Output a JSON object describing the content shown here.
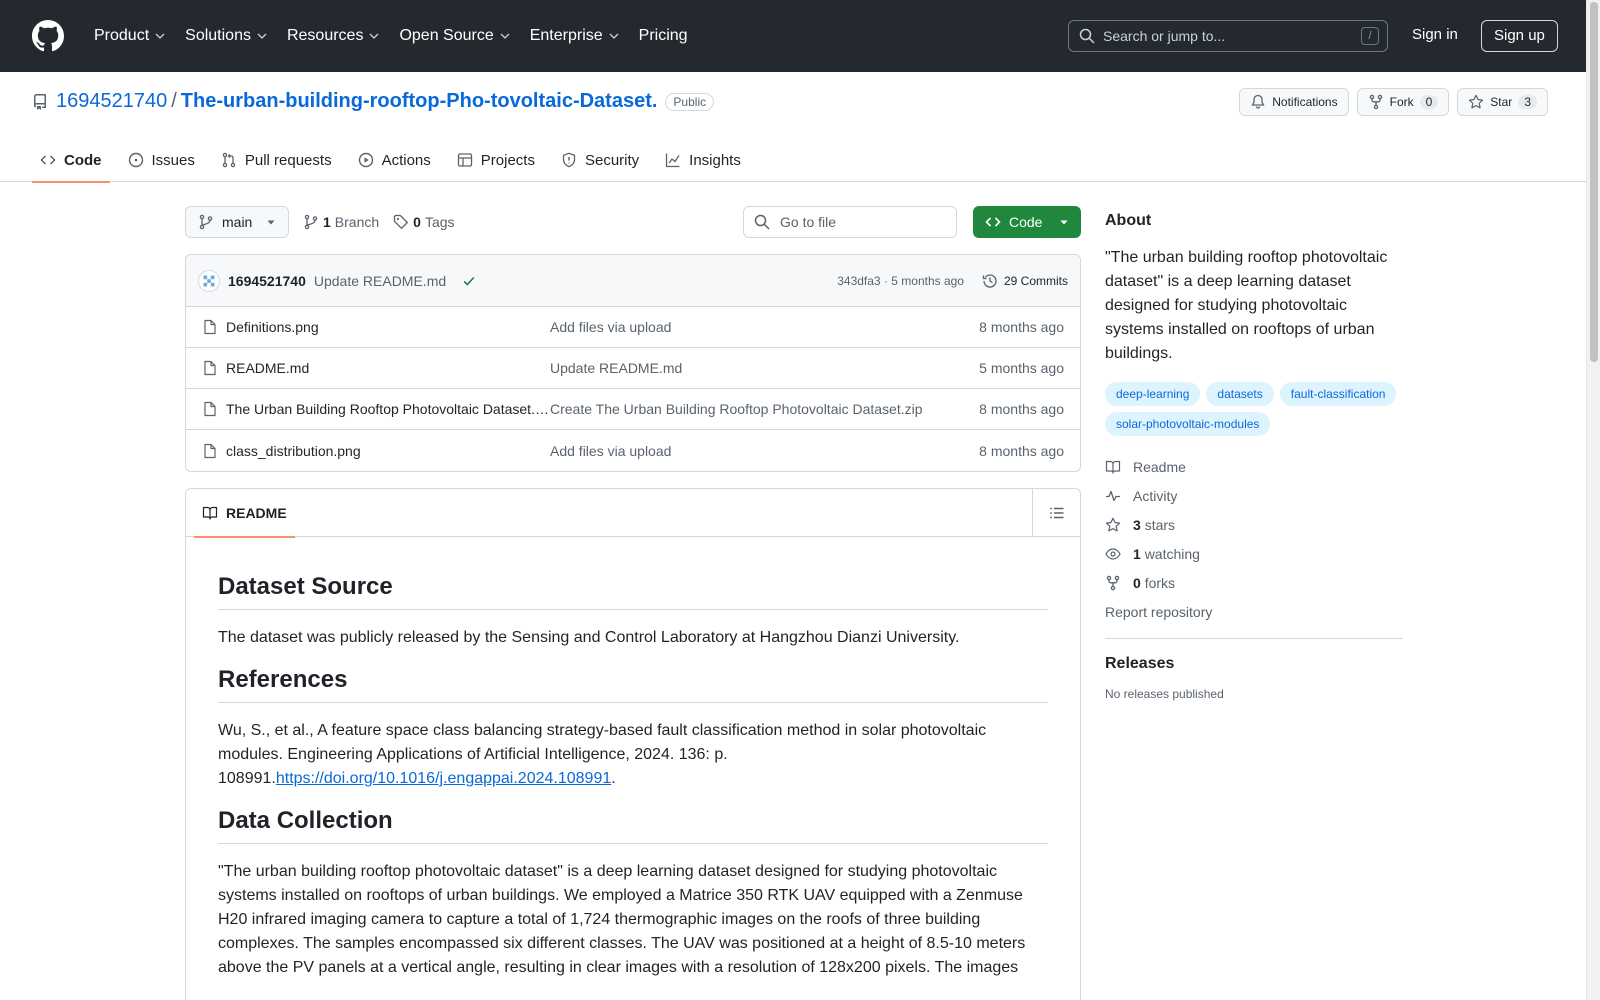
{
  "header": {
    "nav": [
      {
        "label": "Product",
        "has_menu": true
      },
      {
        "label": "Solutions",
        "has_menu": true
      },
      {
        "label": "Resources",
        "has_menu": true
      },
      {
        "label": "Open Source",
        "has_menu": true
      },
      {
        "label": "Enterprise",
        "has_menu": true
      },
      {
        "label": "Pricing",
        "has_menu": false
      }
    ],
    "search_placeholder": "Search or jump to...",
    "search_shortcut": "/",
    "sign_in": "Sign in",
    "sign_up": "Sign up"
  },
  "repo": {
    "owner": "1694521740",
    "separator": "/",
    "name": "The-urban-building-rooftop-Pho-tovoltaic-Dataset.",
    "visibility": "Public",
    "notifications_label": "Notifications",
    "fork_label": "Fork",
    "fork_count": "0",
    "star_label": "Star",
    "star_count": "3",
    "tabs": [
      {
        "label": "Code",
        "icon": "code-icon",
        "active": true
      },
      {
        "label": "Issues",
        "icon": "issue-icon",
        "active": false
      },
      {
        "label": "Pull requests",
        "icon": "pull-request-icon",
        "active": false
      },
      {
        "label": "Actions",
        "icon": "play-icon",
        "active": false
      },
      {
        "label": "Projects",
        "icon": "table-icon",
        "active": false
      },
      {
        "label": "Security",
        "icon": "shield-icon",
        "active": false
      },
      {
        "label": "Insights",
        "icon": "graph-icon",
        "active": false
      }
    ]
  },
  "toolbar": {
    "branch": "main",
    "branch_count": "1",
    "branch_label": "Branch",
    "tag_count": "0",
    "tag_label": "Tags",
    "goto_placeholder": "Go to file",
    "code_button": "Code"
  },
  "latest_commit": {
    "author": "1694521740",
    "message": "Update README.md",
    "meta": "343dfa3 · 5 months ago",
    "commits_label": "29 Commits"
  },
  "files": [
    {
      "name": "Definitions.png",
      "commit": "Add files via upload",
      "age": "8 months ago"
    },
    {
      "name": "README.md",
      "commit": "Update README.md",
      "age": "5 months ago"
    },
    {
      "name": "The Urban Building Rooftop Photovoltaic Dataset.zip",
      "commit": "Create The Urban Building Rooftop Photovoltaic Dataset.zip",
      "age": "8 months ago"
    },
    {
      "name": "class_distribution.png",
      "commit": "Add files via upload",
      "age": "8 months ago"
    }
  ],
  "readme": {
    "tab_label": "README",
    "h_source": "Dataset Source",
    "p_source": "The dataset was publicly released by the Sensing and Control Laboratory at Hangzhou Dianzi University.",
    "h_refs": "References",
    "p_refs": "Wu, S., et al., A feature space class balancing strategy-based fault classification method in solar photovoltaic modules. Engineering Applications of Artificial Intelligence, 2024. 136: p. 108991.",
    "refs_link": "https://doi.org/10.1016/j.engappai.2024.108991",
    "refs_end": ".",
    "h_collection": "Data Collection",
    "p_collection": "\"The urban building rooftop photovoltaic dataset\" is a deep learning dataset designed for studying photovoltaic systems installed on rooftops of urban buildings. We employed a Matrice 350 RTK UAV equipped with a Zenmuse H20 infrared imaging camera to capture a total of 1,724 thermographic images on the roofs of three building complexes. The samples encompassed six different classes. The UAV was positioned at a height of 8.5-10 meters above the PV panels at a vertical angle, resulting in clear images with a resolution of 128x200 pixels. The images"
  },
  "about": {
    "heading": "About",
    "description": "\"The urban building rooftop photovoltaic dataset\" is a deep learning dataset designed for studying photovoltaic systems installed on rooftops of urban buildings.",
    "topics": [
      "deep-learning",
      "datasets",
      "fault-classification",
      "solar-photovoltaic-modules"
    ],
    "readme_label": "Readme",
    "activity_label": "Activity",
    "stars_count": "3",
    "stars_label": "stars",
    "watching_count": "1",
    "watching_label": "watching",
    "forks_count": "0",
    "forks_label": "forks",
    "report": "Report repository"
  },
  "releases": {
    "heading": "Releases",
    "empty": "No releases published"
  },
  "colors": {
    "header_bg": "#24292f",
    "link": "#0969da",
    "code_button": "#1f883d",
    "active_tab_underline": "#fd8c73",
    "topic_bg": "#ddf4ff"
  }
}
